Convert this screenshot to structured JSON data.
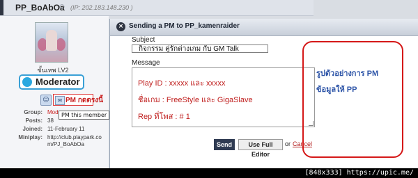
{
  "post": {
    "username": "PP_BoAbOa",
    "ip": "(IP: 202.183.148.230 )",
    "rank": "ขั้นเทพ LV2",
    "badge": "Moderator",
    "pm_link": "PM กดตรงนี้",
    "pm_tooltip": "PM this member",
    "stats": [
      {
        "label": "Group:",
        "value": "Mod"
      },
      {
        "label": "Posts:",
        "value": "38"
      },
      {
        "label": "Joined:",
        "value": "11-February 11"
      },
      {
        "label": "Miniplay:",
        "value": "http://club.playpark.co"
      },
      {
        "label": "",
        "value": "m/PJ_BoAbOa"
      }
    ]
  },
  "dialog": {
    "title": "Sending a PM to PP_kamenraider",
    "subject_label": "Subject",
    "subject_value": "กิจกรรม  คู่รักต่างเกม  กับ  GM Talk",
    "message_label": "Message",
    "message_lines": [
      "Play ID : xxxxx และ   xxxxx",
      "ชื่อเกม : FreeStyle และ   GigaSlave",
      "Rep ที่โพส  :  # 1"
    ],
    "send_label": "Send",
    "full_editor_label": "Use Full Editor",
    "or_text": "or",
    "cancel_label": "Cancel"
  },
  "annotation": {
    "line1": "รูปตัวอย่างการ   PM",
    "line2": "ข้อมูลให้   PP",
    "color": "#d51818"
  },
  "footer": {
    "watermark": "[848x333] https://upic.me/"
  }
}
